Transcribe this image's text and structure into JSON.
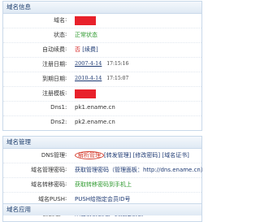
{
  "domain_info": {
    "header": "域名信息",
    "rows": [
      {
        "label": "域名",
        "redacted": true
      },
      {
        "label": "状态",
        "value": "正常状态"
      },
      {
        "label": "自动续费",
        "value_no": "否",
        "value_bracket": "[续费]"
      },
      {
        "label": "注册日期",
        "date": "2007-4-14",
        "time": "17:15:16"
      },
      {
        "label": "到期日期",
        "date": "2010-4-14",
        "time": "17:15:07"
      },
      {
        "label": "注册模板",
        "redacted": true
      },
      {
        "label": "Dns1",
        "value": "pk1.ename.cn"
      },
      {
        "label": "Dns2",
        "value": "pk2.ename.cn"
      }
    ]
  },
  "domain_manage": {
    "header": "域名管理",
    "rows": [
      {
        "label": "DNS管理",
        "circled": "解析管理",
        "rest": "[转发管理] [修改密码] [域名证书]"
      },
      {
        "label": "域名管理密码",
        "value": "获取管理密码（管理面板：http://dns.ename.cn）"
      },
      {
        "label": "域名转移密码",
        "value": "获取转移密码到手机上"
      },
      {
        "label": "域名PUSH",
        "value": "PUSH给指定会员ID号"
      },
      {
        "label": "模板过户",
        "value": "从当前模板过户到指定模板"
      }
    ]
  },
  "domain_app": {
    "header": "域名应用"
  },
  "colors": {
    "accent": "#1e3a73",
    "ok": "#2f9a2f",
    "warn": "#d62424",
    "circle": "#d43a2b"
  }
}
